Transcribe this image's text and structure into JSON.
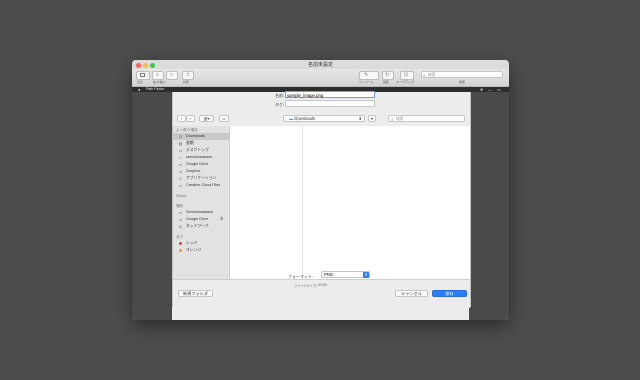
{
  "window": {
    "title": "名前未設定"
  },
  "toolbar": {
    "left": [
      {
        "label": "表示",
        "icon": "view-icon"
      },
      {
        "label": "拡大/縮小",
        "icon": "zoom-icon"
      },
      {
        "label": "共有",
        "icon": "share-icon"
      }
    ],
    "right": [
      {
        "label": "ペンツール",
        "icon": "pen-icon"
      },
      {
        "label": "回転",
        "icon": "rotate-icon"
      },
      {
        "label": "マークアップ",
        "icon": "markup-icon"
      }
    ],
    "search_placeholder": "検索",
    "search_label": "検索"
  },
  "tabbar": {
    "panel_title": "Path Finder"
  },
  "dialog": {
    "name_label": "名前:",
    "name_value": "sample_image.png",
    "tags_label": "タグ:",
    "location": "Downloads",
    "search_placeholder": "検索",
    "sidebar": {
      "favorites_header": "よく使う項目",
      "favorites": [
        {
          "label": "Downloads",
          "icon": "downloads-icon",
          "selected": true
        },
        {
          "label": "書類",
          "icon": "documents-icon"
        },
        {
          "label": "デスクトップ",
          "icon": "desktop-icon"
        },
        {
          "label": "sehirokosakazu",
          "icon": "home-icon"
        },
        {
          "label": "Google Drive",
          "icon": "drive-icon"
        },
        {
          "label": "Dropbox",
          "icon": "dropbox-icon"
        },
        {
          "label": "アプリケーション",
          "icon": "applications-icon"
        },
        {
          "label": "Creative Cloud Files",
          "icon": "creative-cloud-icon"
        }
      ],
      "icloud_header": "iCloud",
      "locations_header": "場所",
      "locations": [
        {
          "label": "Sehirokosakazu",
          "icon": "computer-icon"
        },
        {
          "label": "Google Drive",
          "icon": "drive-icon",
          "eject": "≜"
        },
        {
          "label": "ネットワーク",
          "icon": "network-icon"
        }
      ],
      "tags_header": "タグ",
      "tags": [
        {
          "label": "レッド",
          "color": "#e0443e"
        },
        {
          "label": "オレンジ",
          "color": "#f39a2c"
        }
      ]
    },
    "format_label": "フォーマット:",
    "format_value": "PNG",
    "filesize_label": "ファイルサイズ:",
    "filesize_value": "60 KB",
    "new_folder": "新規フォルダ",
    "cancel": "キャンセル",
    "save": "保存"
  },
  "colors": {
    "accent": "#2d7cf6",
    "desktop": "#4d4d4d"
  }
}
